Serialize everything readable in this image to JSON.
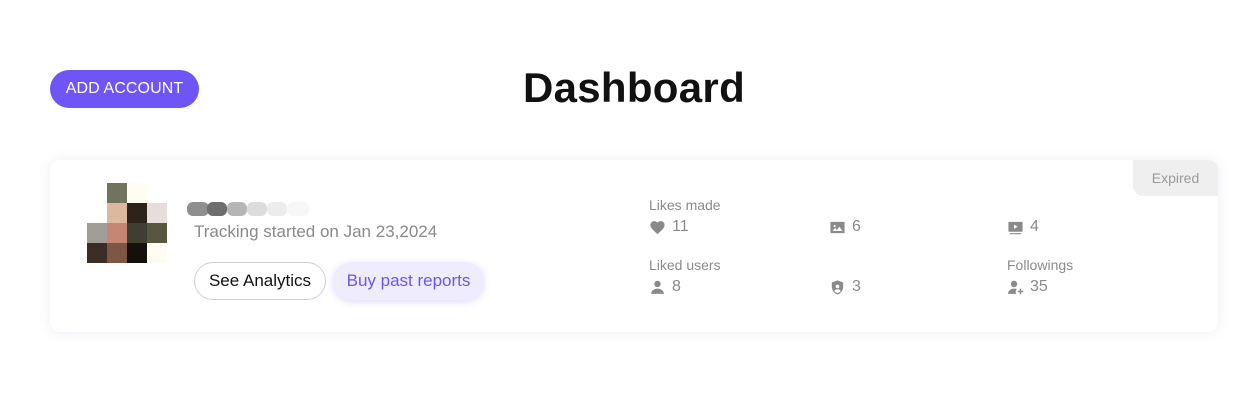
{
  "header": {
    "add_account_label": "ADD ACCOUNT",
    "title": "Dashboard"
  },
  "account": {
    "status": "Expired",
    "tracking": "Tracking started on Jan 23,2024",
    "actions": {
      "analytics_label": "See Analytics",
      "buy_label": "Buy past reports"
    },
    "stats": {
      "likes_made": {
        "label": "Likes made",
        "value": "11",
        "icon": "heart-icon"
      },
      "photos": {
        "value": "6",
        "icon": "photo-icon"
      },
      "videos": {
        "value": "4",
        "icon": "video-icon"
      },
      "liked_users": {
        "label": "Liked users",
        "value": "8",
        "icon": "user-icon"
      },
      "shield": {
        "value": "3",
        "icon": "shield-user-icon"
      },
      "followings": {
        "label": "Followings",
        "value": "35",
        "icon": "user-plus-icon"
      }
    }
  },
  "colors": {
    "accent": "#6f55f6",
    "accent_soft": "#efecfe",
    "muted_text": "#8a8a8a",
    "badge_bg": "#efefef"
  }
}
